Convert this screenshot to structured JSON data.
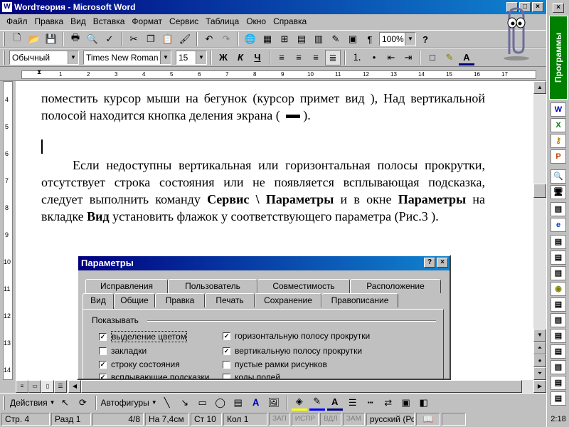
{
  "window": {
    "title": "Wordтеория - Microsoft Word",
    "icon": "W"
  },
  "menu": [
    "Файл",
    "Правка",
    "Вид",
    "Вставка",
    "Формат",
    "Сервис",
    "Таблица",
    "Окно",
    "Справка"
  ],
  "standard_toolbar": {
    "zoom": "100%",
    "help_symbol": "?"
  },
  "format_toolbar": {
    "style": "Обычный",
    "font": "Times New Roman",
    "size": "15",
    "bold": "Ж",
    "italic": "К",
    "underline": "Ч",
    "font_color_letter": "A"
  },
  "document": {
    "para1": "поместить курсор мыши на бегунок (курсор примет вид   ), Над вертикальной полосой находится кнопка деления экрана (",
    "para1_end": ").",
    "para2_a": "Если недоступны вертикальная или горизонтальная полосы прокрутки, отсутствует строка состояния или не появляется всплывающая подсказка, следует выполнить команду ",
    "para2_b1": "Сервис \\ Параметры",
    "para2_c": " и в окне ",
    "para2_b2": "Параметры",
    "para2_d": " на вкладке ",
    "para2_b3": "Вид",
    "para2_e": " установить флажок у соответствующего параметра (Рис.3 )."
  },
  "dialog": {
    "title": "Параметры",
    "help_btn": "?",
    "close_btn": "×",
    "tabs_back": [
      "Исправления",
      "Пользователь",
      "Совместимость",
      "Расположение"
    ],
    "tabs_front": [
      "Вид",
      "Общие",
      "Правка",
      "Печать",
      "Сохранение",
      "Правописание"
    ],
    "group": "Показывать",
    "left_checks": [
      {
        "label": "выделение цветом",
        "checked": true
      },
      {
        "label": "закладки",
        "checked": false
      },
      {
        "label": "строку состояния",
        "checked": true
      },
      {
        "label": "всплывающие подсказки",
        "checked": true
      }
    ],
    "right_checks": [
      {
        "label": "горизонтальную полосу прокрутки",
        "checked": true
      },
      {
        "label": "вертикальную полосу прокрутки",
        "checked": true
      },
      {
        "label": "пустые рамки рисунков",
        "checked": false
      },
      {
        "label": "коды полей",
        "checked": false
      }
    ]
  },
  "drawing_toolbar": {
    "actions": "Действия",
    "autoshapes": "Автофигуры",
    "font_color_letter": "A"
  },
  "status": {
    "page": "Стр. 4",
    "section": "Разд 1",
    "pages": "4/8",
    "at": "На 7,4см",
    "line": "Ст 10",
    "col": "Кол 1",
    "rec": "ЗАП",
    "trk": "ИСПР",
    "ext": "ВДЛ",
    "ovr": "ЗАМ",
    "lang": "русский (Ро"
  },
  "shortcut_bar": {
    "programs": "Программы",
    "clock": "2:18",
    "word_icon": "W"
  },
  "ruler": {
    "h_ticks": [
      "1",
      "2",
      "3",
      "4",
      "5",
      "6",
      "7",
      "8",
      "9",
      "10",
      "11",
      "12",
      "13",
      "14",
      "15",
      "16",
      "17"
    ],
    "v_ticks": [
      "4",
      "5",
      "6",
      "7",
      "8",
      "9",
      "10",
      "11",
      "12",
      "13",
      "14"
    ]
  }
}
